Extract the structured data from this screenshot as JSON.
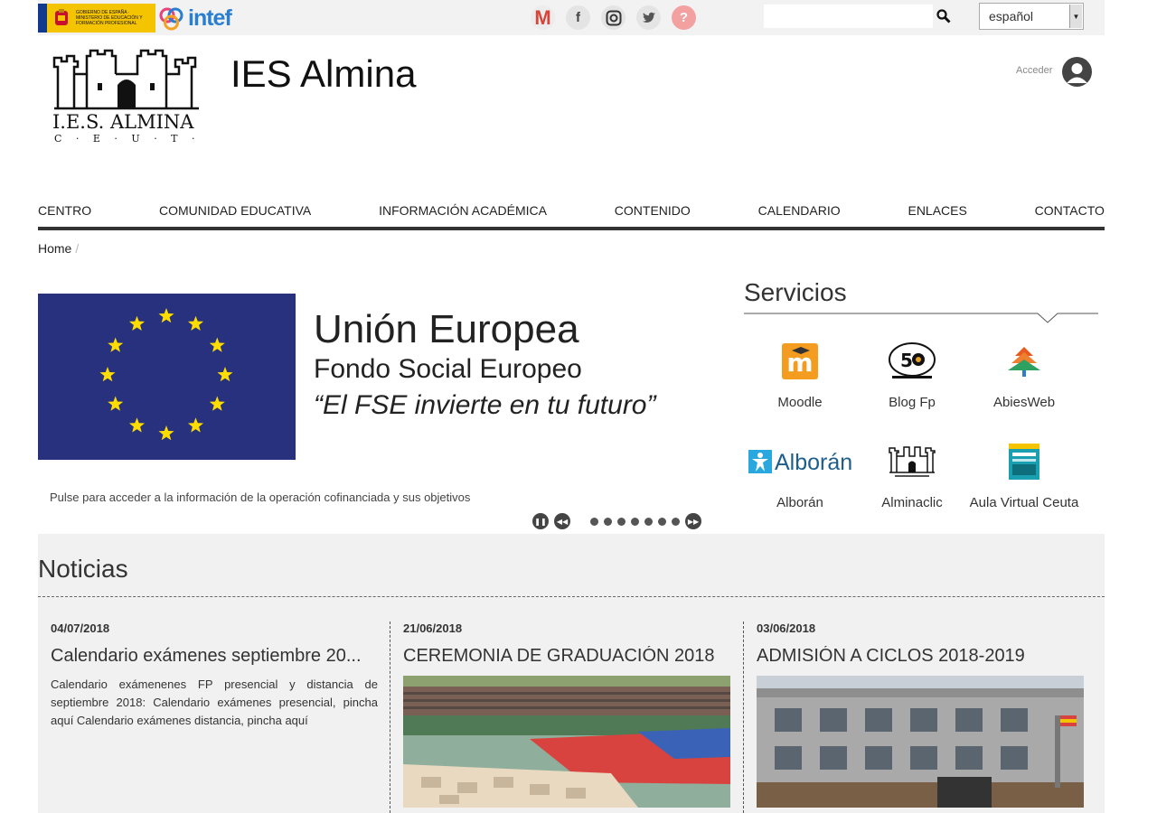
{
  "topbar": {
    "gov_logo_text": "Gobierno de España · Ministerio de Educación y Formación Profesional",
    "intef_text": "intef",
    "social_icons": [
      "gmail-icon",
      "facebook-icon",
      "instagram-icon",
      "twitter-icon",
      "help-icon"
    ],
    "social_glyphs": {
      "gmail": "M",
      "facebook": "f",
      "instagram": "◎",
      "twitter": "🐦",
      "help": "?"
    },
    "search_value": "",
    "language_selected": "español"
  },
  "header": {
    "site_title": "IES Almina",
    "logo_text": "I.E.S. ALMINA",
    "logo_subtext": "C · E · U · T · A",
    "login_label": "Acceder"
  },
  "nav": {
    "items": [
      "CENTRO",
      "COMUNIDAD EDUCATIVA",
      "INFORMACIÓN ACADÉMICA",
      "CONTENIDO",
      "CALENDARIO",
      "ENLACES",
      "CONTACTO"
    ]
  },
  "breadcrumb": {
    "home": "Home",
    "separator": "/"
  },
  "slider": {
    "slide_title": "Unión Europea",
    "slide_subtitle": "Fondo Social Europeo",
    "slide_quote": "“El FSE invierte en tu futuro”",
    "caption": "Pulse para acceder a la información de la operación cofinanciada y sus objetivos",
    "dot_count": 7
  },
  "services": {
    "title": "Servicios",
    "items": [
      {
        "label": "Moodle",
        "icon": "moodle-icon"
      },
      {
        "label": "Blog Fp",
        "icon": "blog-fp-icon"
      },
      {
        "label": "AbiesWeb",
        "icon": "abiesweb-icon"
      },
      {
        "label": "Alborán",
        "icon": "alboran-icon",
        "icon_text": "Alborán"
      },
      {
        "label": "Alminaclic",
        "icon": "alminaclic-icon"
      },
      {
        "label": "Aula Virtual Ceuta",
        "icon": "aula-virtual-icon"
      }
    ]
  },
  "news": {
    "heading": "Noticias",
    "items": [
      {
        "date": "04/07/2018",
        "title": "Calendario exámenes septiembre 20...",
        "body": "Calendario exámenenes FP presencial y distancia de septiembre 2018: Calendario exámenes presencial, pincha aquí Calendario exámenes distancia, pincha aquí"
      },
      {
        "date": "21/06/2018",
        "title": "CEREMONIA DE GRADUACIÓN 2018"
      },
      {
        "date": "03/06/2018",
        "title": "ADMISIÓN A CICLOS 2018-2019"
      }
    ]
  },
  "colors": {
    "eu_blue": "#27317e",
    "eu_star": "#ffdd00",
    "nav_border": "#333333",
    "news_band": "#f1f1f1"
  }
}
